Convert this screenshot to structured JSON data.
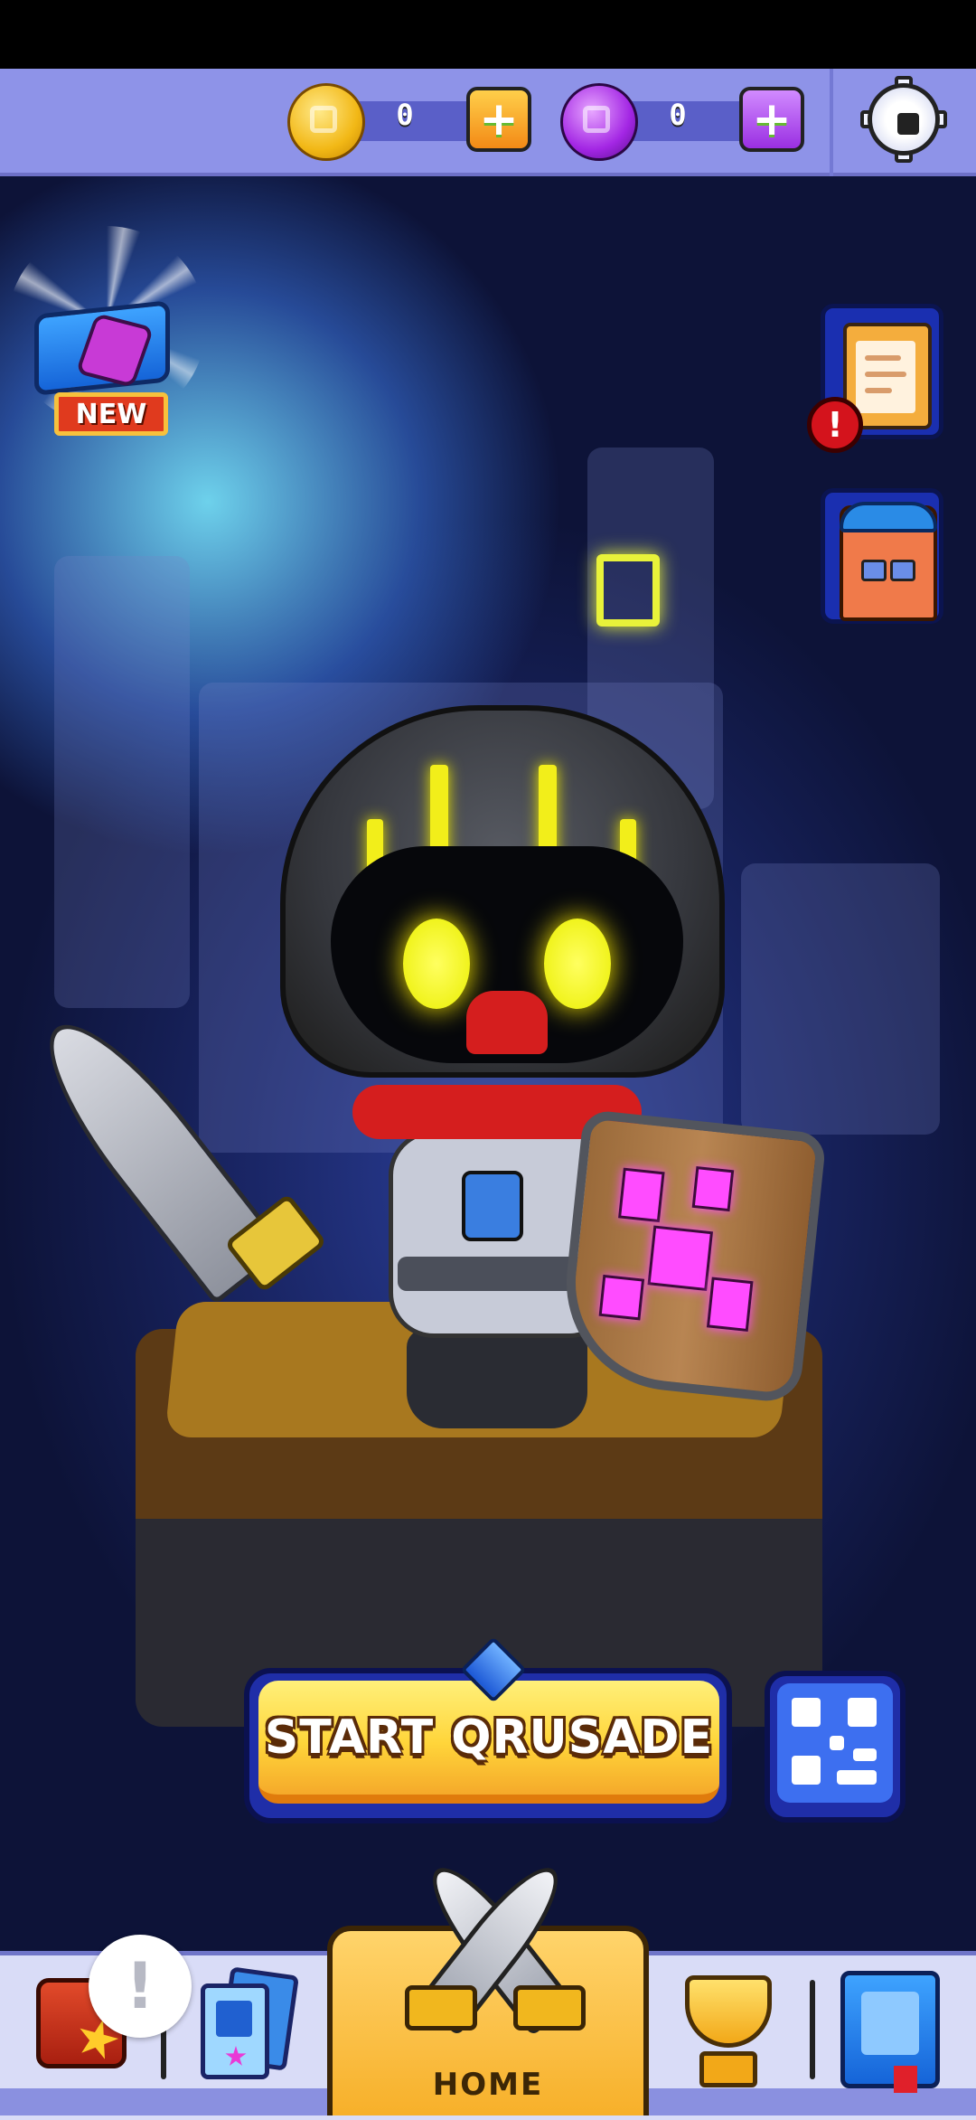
{
  "currency": {
    "coins": {
      "value": "0",
      "icon": "gold-coin-icon",
      "color": "#f2b816"
    },
    "gems": {
      "value": "0",
      "icon": "purple-gem-icon",
      "color": "#a326e4"
    }
  },
  "header": {
    "settings_icon": "gear-icon"
  },
  "new_chest": {
    "badge": "NEW",
    "icon": "treasure-chest-icon"
  },
  "side_buttons": [
    {
      "name": "quests",
      "icon": "clipboard-icon",
      "alert": "!"
    },
    {
      "name": "wardrobe",
      "icon": "wardrobe-icon"
    }
  ],
  "main": {
    "start_label": "START QRUSADE",
    "qr_icon": "qr-code-icon"
  },
  "bottom_nav": {
    "tabs": [
      {
        "icon": "chest-icon"
      },
      {
        "icon": "cards-icon"
      },
      {
        "label": "HOME",
        "icon": "crossed-swords-icon"
      },
      {
        "icon": "trophy-icon"
      },
      {
        "icon": "book-icon"
      }
    ],
    "notification": "!"
  },
  "colors": {
    "accent": "#ffd53a",
    "topbar": "#8e93e8",
    "nav": "#d9dcf7"
  }
}
